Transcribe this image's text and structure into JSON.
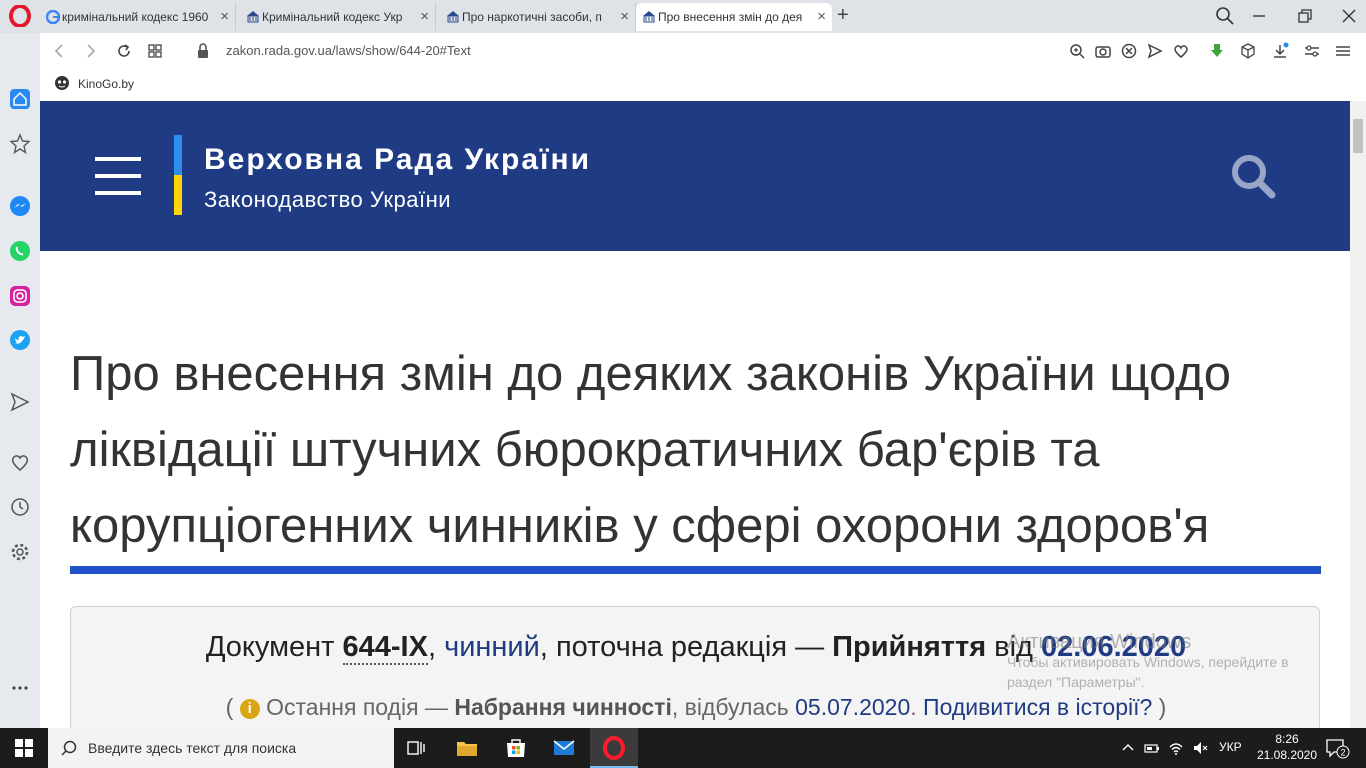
{
  "browser": {
    "tabs": [
      {
        "label": "кримінальний кодекс 1960",
        "favicon": "google-icon",
        "active": false
      },
      {
        "label": "Кримінальний кодекс Укр",
        "favicon": "rada-icon",
        "active": false
      },
      {
        "label": "Про наркотичні засоби, п",
        "favicon": "rada-icon",
        "active": false
      },
      {
        "label": "Про внесення змін до дея",
        "favicon": "rada-icon",
        "active": true
      }
    ],
    "new_tab_label": "+",
    "url": "zakon.rada.gov.ua/laws/show/644-20#Text",
    "bookmark": {
      "label": "KinoGo.by"
    }
  },
  "site": {
    "title": "Верховна Рада України",
    "subtitle": "Законодавство України"
  },
  "document": {
    "title": "Про внесення змін до деяких законів України щодо ліквідації штучних бюрократичних бар'єрів та корупціогенних чинників у сфері охорони здоров'я",
    "info": {
      "prefix": "Документ ",
      "number": "644-IX",
      "comma": ", ",
      "status": "чинний",
      "mid": ", поточна редакція — ",
      "event": "Прийняття",
      "from": " від ",
      "date": "02.06.2020"
    },
    "last_event": {
      "open": "( ",
      "icon_glyph": "i",
      "label": " Остання подія — ",
      "event": "Набрання чинності",
      "happened": ", відбулась ",
      "date": "05.07.2020",
      "dot": ". ",
      "history_link": "Подивитися в історії?",
      "close": " )"
    }
  },
  "watermark": {
    "line1": "Активация Windows",
    "line2": "Чтобы активировать Windows, перейдите в",
    "line3": "раздел \"Параметры\"."
  },
  "taskbar": {
    "search_placeholder": "Введите здесь текст для поиска",
    "language": "УКР",
    "time": "8:26",
    "date": "21.08.2020",
    "notifications": "2"
  },
  "colors": {
    "header_bg": "#1f3b83",
    "flag_blue": "#2e8ef0",
    "flag_yellow": "#ffd500",
    "title_rule": "#1f52c8",
    "link": "#1f3b83"
  }
}
